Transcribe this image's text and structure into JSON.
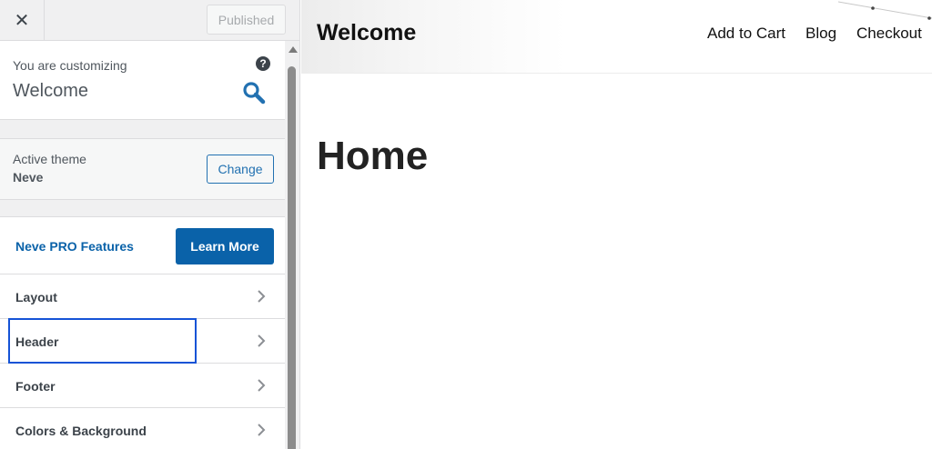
{
  "topbar": {
    "close_glyph": "✕",
    "publish_label": "Published"
  },
  "info": {
    "customizing_label": "You are customizing",
    "site_name": "Welcome",
    "help_glyph": "?"
  },
  "theme": {
    "label": "Active theme",
    "name": "Neve",
    "change_label": "Change"
  },
  "pro": {
    "label": "Neve PRO Features",
    "button_label": "Learn More"
  },
  "menu": {
    "items": [
      {
        "label": "Layout"
      },
      {
        "label": "Header"
      },
      {
        "label": "Footer"
      },
      {
        "label": "Colors & Background"
      }
    ]
  },
  "preview": {
    "site_title": "Welcome",
    "nav": [
      "Add to Cart",
      "Blog",
      "Checkout"
    ],
    "page_title": "Home"
  },
  "colors": {
    "accent": "#2271b1",
    "pro_blue": "#0a62a9",
    "highlight": "#1553d6"
  },
  "icons": {
    "close": "close-icon",
    "help": "help-icon",
    "search": "search-icon",
    "chevron": "chevron-right-icon"
  }
}
